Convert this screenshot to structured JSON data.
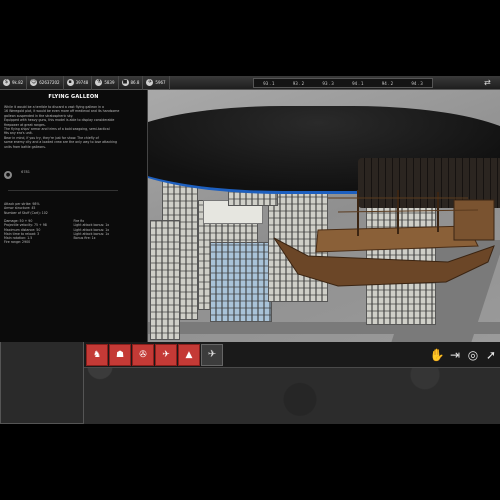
{
  "topbar": {
    "resources": [
      {
        "icon": "money-icon",
        "glyph": "$",
        "value": "9k.82"
      },
      {
        "icon": "population-icon",
        "glyph": "☺",
        "value": "62637202"
      },
      {
        "icon": "vehicle-icon",
        "glyph": "▪",
        "value": "39748"
      },
      {
        "icon": "research-icon",
        "glyph": "⚗",
        "value": "5839"
      },
      {
        "icon": "power-icon",
        "glyph": "■",
        "value": "86.8"
      },
      {
        "icon": "airship-icon",
        "glyph": "✈",
        "value": "5967"
      }
    ],
    "years": [
      "93 . 1",
      "93 . 2",
      "93 . 3",
      "94 . 1",
      "94 . 2",
      "94 . 3"
    ],
    "network_icon": "network-icon"
  },
  "info_panel": {
    "title": "FLYING GALLEON",
    "description": [
      "While it would be a terrible to discard a vast flying galleon in a",
      "16 Weregold plot, it would be even more off medieval and its handsome",
      "galleon suspended in the stratospheric sky.",
      "Equipped with heavy guns, this model is able to display considerable",
      "firepower at great ranges.",
      "The flying ships' armor and trims of a bold seagoing, semi-tactical",
      "fits any era's unit.",
      "Bear in mind, if you try, they're just for show. The chiefly of",
      "some enemy city and a loaded crew are the only way to lose attacking",
      "units from battle galleons."
    ],
    "section_value": "6781",
    "stats_a": [
      "Attack per strike: 98%",
      "Armor structure: 45",
      "Number of Stuff (Cart): 102"
    ],
    "stats_b_left": [
      "Damage: 50 + 90",
      "Projectile velocity: 75 + 98",
      "Maximum distance: 50",
      "Main time to reload: 3",
      "Main rotation: 1.5",
      "Fire range: 2900"
    ],
    "stats_b_right": [
      "Fire fix",
      "Light attack bonus: 1x",
      "Light attack bonus: 1x",
      "Light attack bonus: 1x",
      "Bonus fire: 1x"
    ]
  },
  "actions": {
    "red_buttons": [
      {
        "name": "unit-infantry-button",
        "glyph": "♞"
      },
      {
        "name": "unit-soldiers-button",
        "glyph": "☗"
      },
      {
        "name": "unit-artillery-button",
        "glyph": "✇"
      },
      {
        "name": "unit-aircraft-button",
        "glyph": "✈"
      },
      {
        "name": "unit-defense-button",
        "glyph": "▲"
      }
    ],
    "gray_button_glyph": "✈",
    "right_buttons": [
      {
        "name": "stop-hand-button",
        "glyph": "✋"
      },
      {
        "name": "exit-button",
        "glyph": "⇥"
      },
      {
        "name": "target-button",
        "glyph": "◎"
      },
      {
        "name": "move-button",
        "glyph": "➚"
      }
    ]
  }
}
